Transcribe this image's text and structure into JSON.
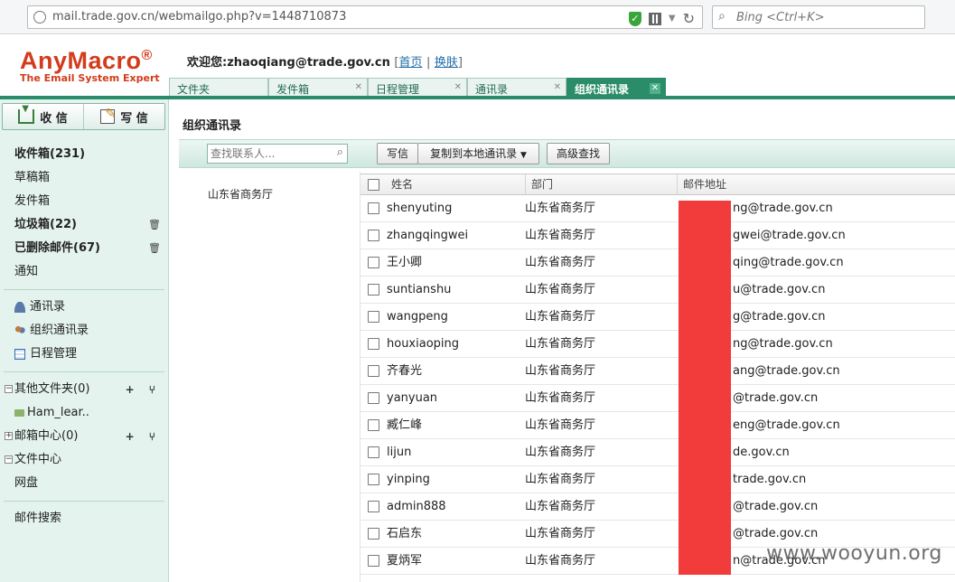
{
  "browser": {
    "url": "mail.trade.gov.cn/webmailgo.php?v=1448710873",
    "search_placeholder": "Bing <Ctrl+K>"
  },
  "header": {
    "logo": "AnyMacro",
    "logo_mark": "®",
    "logo_subtitle": "The Email System Expert",
    "welcome": "欢迎您:zhaoqiang@trade.gov.cn",
    "home_link": "首页",
    "skin_link": "换肤",
    "separator": "|",
    "tabs": [
      {
        "label": "文件夹",
        "closable": false
      },
      {
        "label": "发件箱",
        "closable": true
      },
      {
        "label": "日程管理",
        "closable": true
      },
      {
        "label": "通讯录",
        "closable": true
      },
      {
        "label": "组织通讯录",
        "closable": true,
        "active": true
      }
    ],
    "tab_close": "✕"
  },
  "sidebar": {
    "receive_label": "收 信",
    "write_label": "写 信",
    "folders": [
      {
        "label": "收件箱(231)",
        "bold": true
      },
      {
        "label": "草稿箱"
      },
      {
        "label": "发件箱"
      },
      {
        "label": "垃圾箱(22)",
        "bold": true,
        "trash": true
      },
      {
        "label": "已删除邮件(67)",
        "bold": true,
        "trash": true
      },
      {
        "label": "通知"
      }
    ],
    "tools": [
      {
        "label": "通讯录",
        "icon": "person-icon"
      },
      {
        "label": "组织通讯录",
        "icon": "group-icon"
      },
      {
        "label": "日程管理",
        "icon": "calendar-icon"
      }
    ],
    "other_folders": "其他文件夹(0)",
    "ham_folder": "Ham_lear..",
    "mail_center": "邮箱中心(0)",
    "file_center": "文件中心",
    "netdisk": "网盘",
    "mail_search": "邮件搜索",
    "tree_actions": "+ ⑂",
    "trash_glyph": "🗑"
  },
  "main": {
    "title": "组织通讯录",
    "search_placeholder": "查找联系人...",
    "btn_write": "写信",
    "btn_copy": "复制到本地通讯录",
    "btn_copy_caret": "▼",
    "btn_advanced": "高级查找",
    "org_unit": "山东省商务厅",
    "columns": {
      "name": "姓名",
      "dept": "部门",
      "email": "邮件地址"
    },
    "rows": [
      {
        "name": "shenyuting",
        "dept": "山东省商务厅",
        "email": "ng@trade.gov.cn"
      },
      {
        "name": "zhangqingwei",
        "dept": "山东省商务厅",
        "email": "gwei@trade.gov.cn"
      },
      {
        "name": "王小卿",
        "dept": "山东省商务厅",
        "email": "qing@trade.gov.cn"
      },
      {
        "name": "suntianshu",
        "dept": "山东省商务厅",
        "email": "u@trade.gov.cn"
      },
      {
        "name": "wangpeng",
        "dept": "山东省商务厅",
        "email": "g@trade.gov.cn"
      },
      {
        "name": "houxiaoping",
        "dept": "山东省商务厅",
        "email": "ng@trade.gov.cn"
      },
      {
        "name": "齐春光",
        "dept": "山东省商务厅",
        "email": "ang@trade.gov.cn"
      },
      {
        "name": "yanyuan",
        "dept": "山东省商务厅",
        "email": "@trade.gov.cn"
      },
      {
        "name": "臧仁峰",
        "dept": "山东省商务厅",
        "email": "eng@trade.gov.cn"
      },
      {
        "name": "lijun",
        "dept": "山东省商务厅",
        "email": "de.gov.cn"
      },
      {
        "name": "yinping",
        "dept": "山东省商务厅",
        "email": "trade.gov.cn"
      },
      {
        "name": "admin888",
        "dept": "山东省商务厅",
        "email": "@trade.gov.cn"
      },
      {
        "name": "石启东",
        "dept": "山东省商务厅",
        "email": "@trade.gov.cn"
      },
      {
        "name": "夏炳军",
        "dept": "山东省商务厅",
        "email": "n@trade.gov.cn"
      }
    ]
  },
  "watermark": "www.wooyun.org",
  "colors": {
    "accent": "#2b8c6a",
    "logo": "#d23c1c",
    "redaction": "#f23b3b"
  }
}
